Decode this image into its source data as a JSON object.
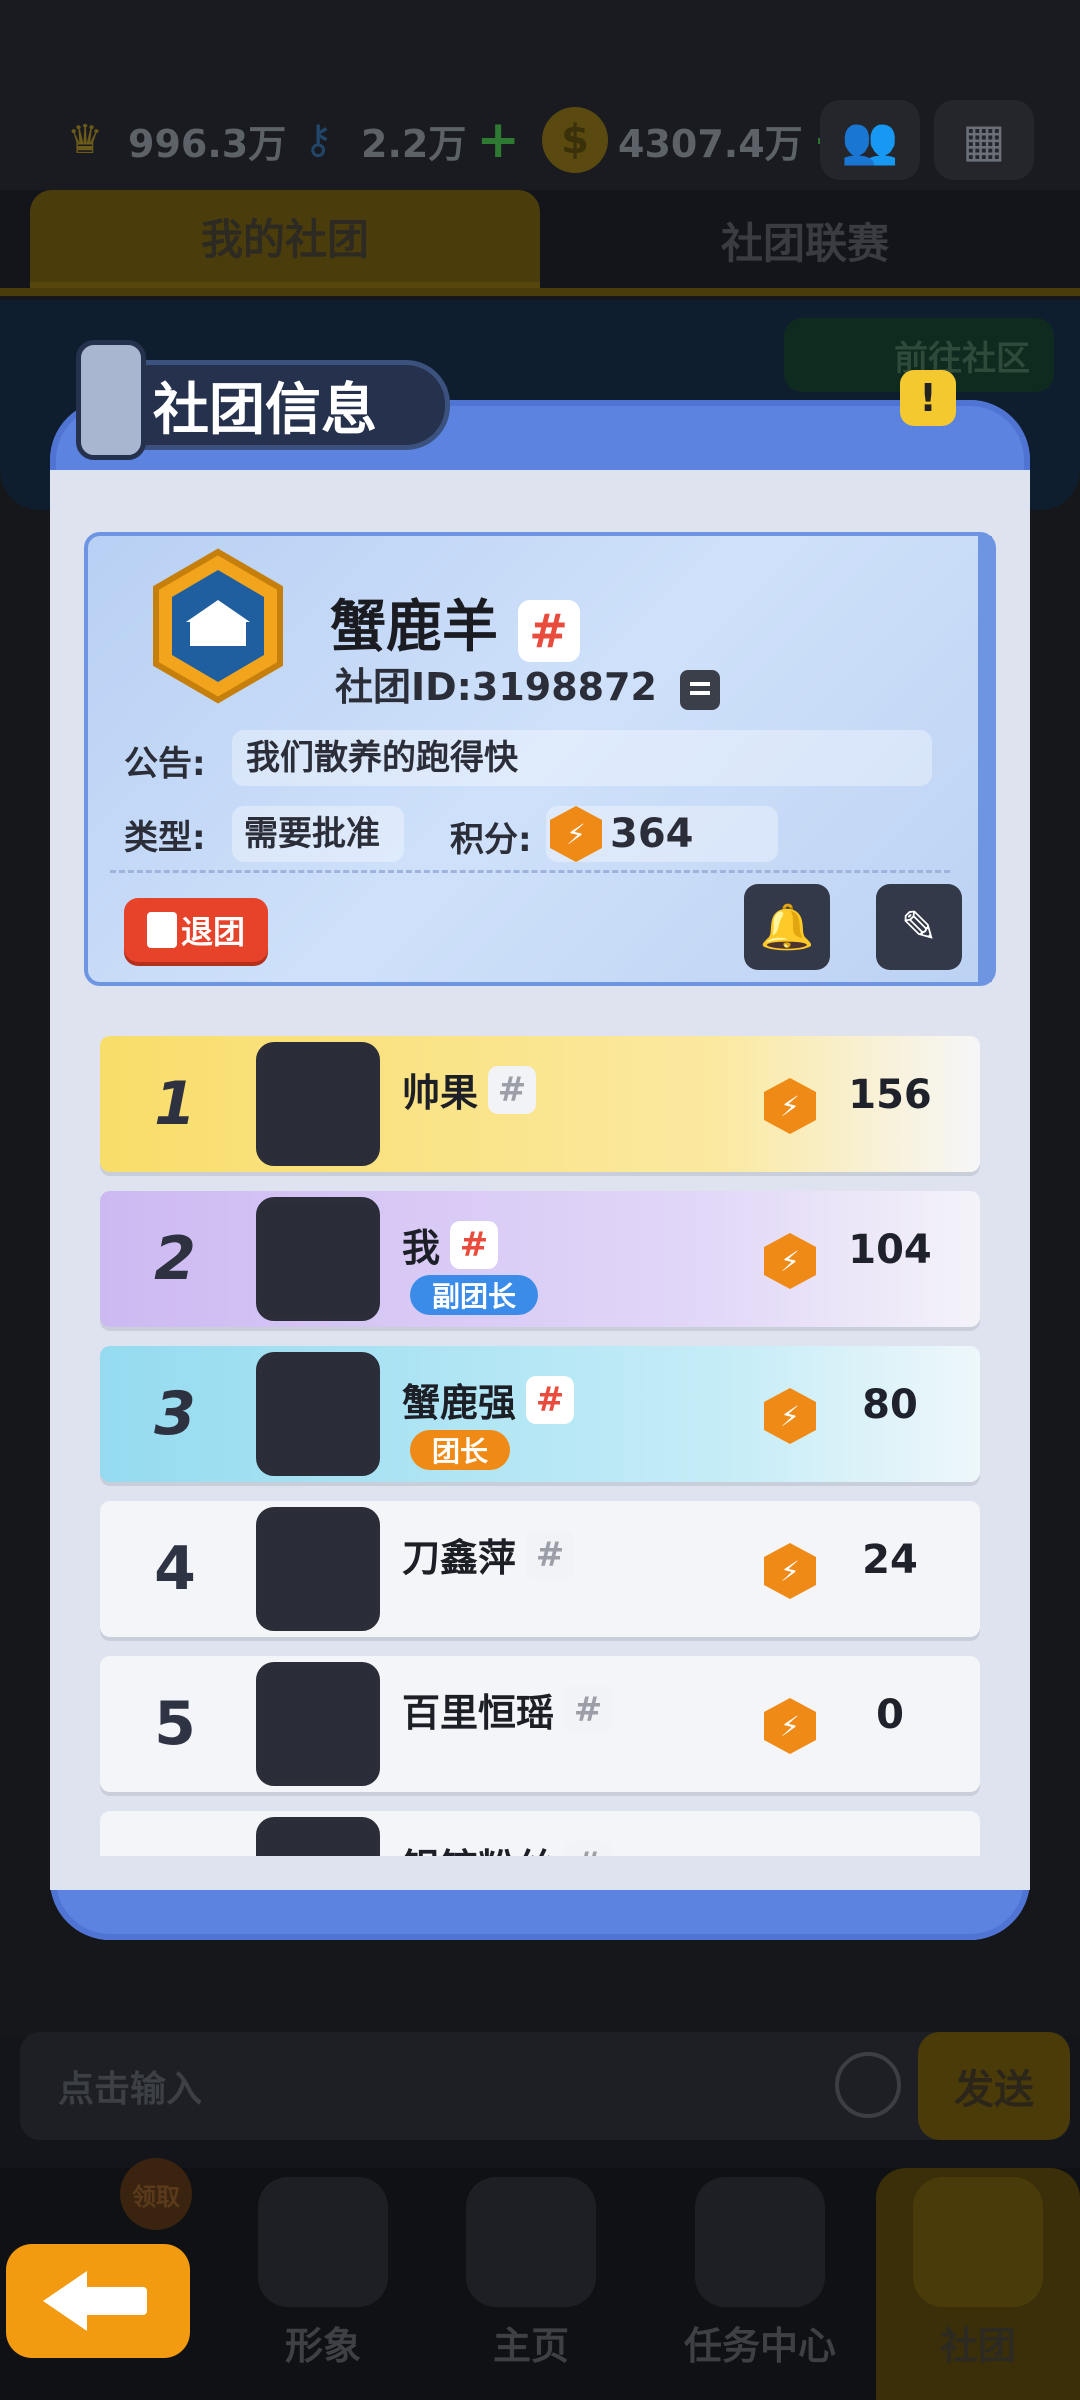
{
  "topbar": {
    "crowns": "996.3万",
    "keys": "2.2万",
    "coins": "4307.4万",
    "plus": "+",
    "icons": [
      "crown-icon",
      "key-icon",
      "coin-icon",
      "friends-icon",
      "menu-icon"
    ]
  },
  "tabs": {
    "my_club": "我的社团",
    "club_league": "社团联赛"
  },
  "background": {
    "go_community": "前往社区"
  },
  "modal": {
    "title": "社团信息",
    "alert": "!",
    "club": {
      "name": "蟹鹿羊",
      "id_label": "社团ID:3198872",
      "announce_label": "公告:",
      "announce_text": "我们散养的跑得快",
      "type_label": "类型:",
      "type_value": "需要批准",
      "score_label": "积分:",
      "score_value": "364",
      "quit_label": "退团"
    },
    "members": [
      {
        "rank": "1",
        "name": "帅果",
        "role": "",
        "points": "156"
      },
      {
        "rank": "2",
        "name": "我",
        "role": "副团长",
        "points": "104"
      },
      {
        "rank": "3",
        "name": "蟹鹿强",
        "role": "团长",
        "points": "80"
      },
      {
        "rank": "4",
        "name": "刀鑫萍",
        "role": "",
        "points": "24"
      },
      {
        "rank": "5",
        "name": "百里恒瑶",
        "role": "",
        "points": "0"
      },
      {
        "rank": "",
        "name": "铝锭粉丝",
        "role": "",
        "points": ""
      }
    ]
  },
  "chat": {
    "placeholder": "点击输入",
    "send": "发送"
  },
  "bottomnav": {
    "claim": "领取",
    "items": [
      "形象",
      "主页",
      "任务中心",
      "社团"
    ]
  },
  "colors": {
    "accent": "#f29a10",
    "modal": "#5c83df",
    "vice": "#3a8ce8",
    "leader": "#f08a16"
  }
}
